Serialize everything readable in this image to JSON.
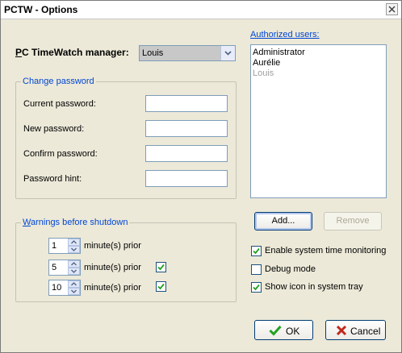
{
  "window": {
    "title": "PCTW - Options"
  },
  "manager": {
    "label": "PC TimeWatch manager:",
    "selected": "Louis"
  },
  "change_password": {
    "title": "Change password",
    "current_label": "Current password:",
    "new_label": "New password:",
    "confirm_label": "Confirm password:",
    "hint_label": "Password hint:",
    "current_value": "",
    "new_value": "",
    "confirm_value": "",
    "hint_value": ""
  },
  "warnings": {
    "title": "Warnings before shutdown",
    "rows": [
      {
        "value": "1",
        "unit": "minute(s) prior",
        "checked": null
      },
      {
        "value": "5",
        "unit": "minute(s) prior",
        "checked": true
      },
      {
        "value": "10",
        "unit": "minute(s) prior",
        "checked": true
      }
    ]
  },
  "authorized": {
    "label": "Authorized users:",
    "users": [
      "Administrator",
      "Aurélie",
      "Louis"
    ],
    "add_label": "Add...",
    "remove_label": "Remove"
  },
  "options": {
    "monitoring": {
      "label": "Enable system time monitoring",
      "checked": true
    },
    "debug": {
      "label": "Debug mode",
      "checked": false
    },
    "tray": {
      "label": "Show icon in system tray",
      "checked": true
    }
  },
  "buttons": {
    "ok": "OK",
    "cancel": "Cancel"
  },
  "colors": {
    "accent_text": "#0046d5",
    "check_green": "#21a121",
    "cancel_x": "#c0281c"
  }
}
